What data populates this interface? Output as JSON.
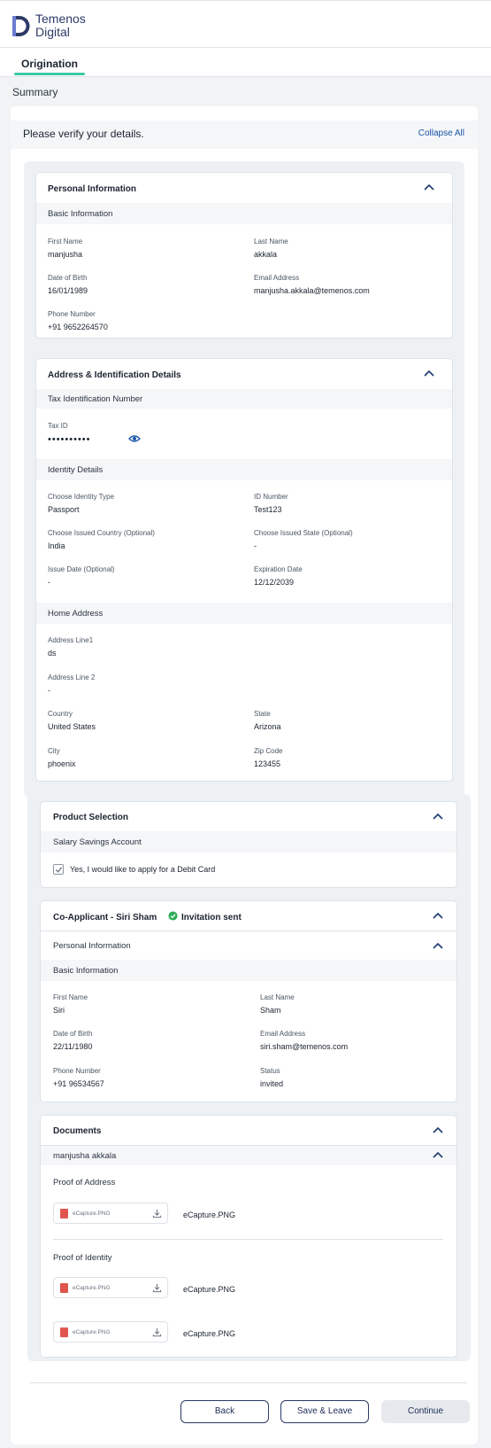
{
  "brand": {
    "line1": "Temenos",
    "line2": "Digital"
  },
  "tabs": [
    {
      "label": "Origination",
      "active": true
    }
  ],
  "page": {
    "section_title": "Summary",
    "verify_text": "Please verify your details.",
    "collapse_all": "Collapse All"
  },
  "personal": {
    "title": "Personal Information",
    "sub": "Basic Information",
    "fields": [
      {
        "label": "First Name",
        "value": "manjusha"
      },
      {
        "label": "Last Name",
        "value": "akkala"
      },
      {
        "label": "Date of Birth",
        "value": "16/01/1989"
      },
      {
        "label": "Email Address",
        "value": "manjusha.akkala@temenos.com"
      },
      {
        "label": "Phone Number",
        "value": "+91 9652264570"
      }
    ]
  },
  "address": {
    "title": "Address & Identification Details",
    "tax_sub": "Tax Identification Number",
    "tax_label": "Tax ID",
    "tax_value": "••••••••••",
    "identity_sub": "Identity Details",
    "identity_fields": [
      {
        "label": "Choose Identity Type",
        "value": "Passport"
      },
      {
        "label": "ID Number",
        "value": "Test123"
      },
      {
        "label": "Choose Issued Country (Optional)",
        "value": "India"
      },
      {
        "label": "Choose Issued State (Optional)",
        "value": "-"
      },
      {
        "label": "Issue Date (Optional)",
        "value": "-"
      },
      {
        "label": "Expiration Date",
        "value": "12/12/2039"
      }
    ],
    "home_sub": "Home Address",
    "home_fields": [
      {
        "label": "Address Line1",
        "value": "ds"
      },
      {
        "label": "Address Line 2",
        "value": "-"
      },
      {
        "label": "Country",
        "value": "United States"
      },
      {
        "label": "State",
        "value": "Arizona"
      },
      {
        "label": "City",
        "value": "phoenix"
      },
      {
        "label": "Zip Code",
        "value": "123455"
      }
    ]
  },
  "product": {
    "title": "Product Selection",
    "account": "Salary Savings Account",
    "debit_card_label": "Yes, I would like to apply for a Debit Card",
    "debit_card_checked": true
  },
  "coapplicant": {
    "title": "Co-Applicant - Siri Sham",
    "status_badge": "Invitation sent",
    "status_color": "#2eae57",
    "personal_title": "Personal Information",
    "basic_sub": "Basic Information",
    "fields": [
      {
        "label": "First Name",
        "value": "Siri"
      },
      {
        "label": "Last Name",
        "value": "Sham"
      },
      {
        "label": "Date of Birth",
        "value": "22/11/1980"
      },
      {
        "label": "Email Address",
        "value": "siri.sham@temenos.com"
      },
      {
        "label": "Phone Number",
        "value": "+91 96534567"
      },
      {
        "label": "Status",
        "value": "invited"
      }
    ]
  },
  "documents": {
    "title": "Documents",
    "owner": "manjusha akkala",
    "proof_address": "Proof of Address",
    "proof_identity": "Proof of Identity",
    "files": [
      {
        "mini": "eCapture.PNG",
        "name": "eCapture.PNG"
      },
      {
        "mini": "eCapture.PNG",
        "name": "eCapture.PNG"
      },
      {
        "mini": "eCapture.PNG",
        "name": "eCapture.PNG"
      }
    ]
  },
  "actions": {
    "back": "Back",
    "save_leave": "Save & Leave",
    "continue": "Continue"
  },
  "colors": {
    "accent": "#3bc9a4",
    "link": "#1a55a8",
    "brand": "#2c3a66"
  },
  "icons": [
    "logo-icon",
    "chevron-up-icon",
    "eye-icon",
    "check-icon",
    "check-circle-icon",
    "file-icon",
    "download-icon"
  ]
}
